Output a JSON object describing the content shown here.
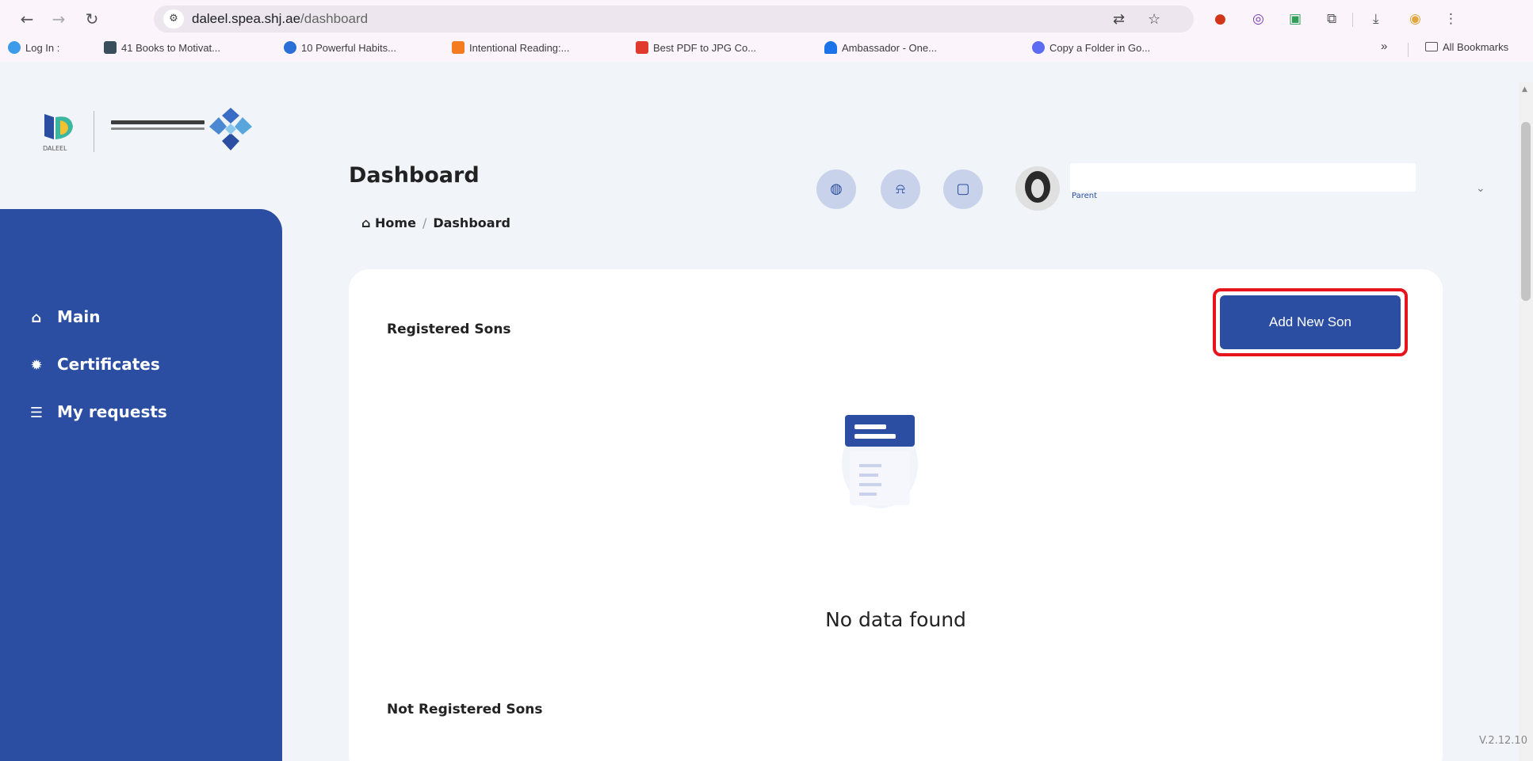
{
  "browser": {
    "url_host": "daleel.spea.shj.ae",
    "url_path": "/dashboard",
    "bookmarks": [
      {
        "label": "Log In :",
        "color": "#3d9be9"
      },
      {
        "label": "41 Books to Motivat...",
        "color": "#3a4f5c"
      },
      {
        "label": "10 Powerful Habits...",
        "color": "#2b6fd6"
      },
      {
        "label": "Intentional Reading:...",
        "color": "#f47b20"
      },
      {
        "label": "Best PDF to JPG Co...",
        "color": "#e03a2f"
      },
      {
        "label": "Ambassador - One...",
        "color": "#1a73e8"
      },
      {
        "label": "Copy a Folder in Go...",
        "color": "#5b6cf3"
      }
    ],
    "more_bookmarks": "»",
    "all_bookmarks": "All Bookmarks"
  },
  "logo": {
    "word": "DALEEL"
  },
  "sidebar": {
    "items": [
      {
        "label": "Main",
        "icon": "home-icon"
      },
      {
        "label": "Certificates",
        "icon": "certificate-icon"
      },
      {
        "label": "My requests",
        "icon": "list-icon"
      }
    ]
  },
  "header": {
    "title": "Dashboard",
    "breadcrumb_home": "Home",
    "breadcrumb_sep": "/",
    "breadcrumb_current": "Dashboard",
    "user_role": "Parent"
  },
  "main": {
    "registered_heading": "Registered Sons",
    "add_button": "Add New Son",
    "empty_text": "No data found",
    "not_registered_heading": "Not Registered Sons"
  },
  "footer": {
    "version": "V.2.12.10"
  },
  "colors": {
    "primary": "#2b4ea2",
    "highlight": "#e8141c",
    "background": "#f1f4f9"
  }
}
